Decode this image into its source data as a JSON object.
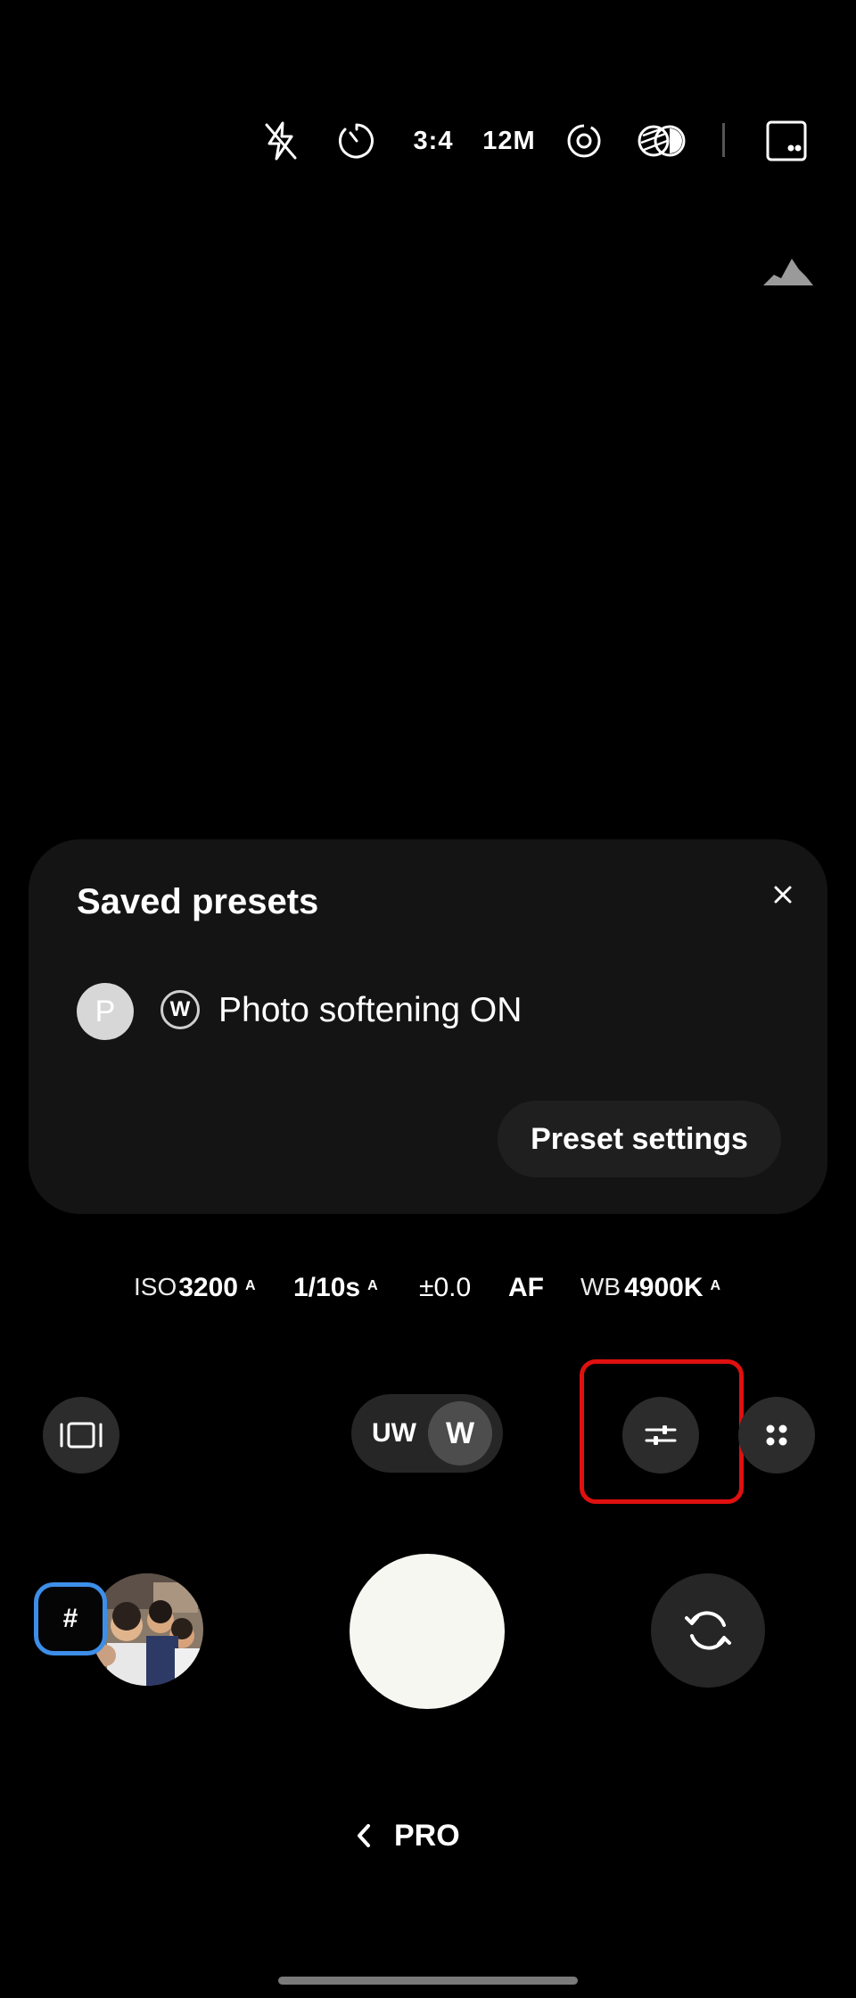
{
  "top_bar": {
    "flash_icon": "flash-off-icon",
    "timer_icon": "timer-icon",
    "aspect_ratio": "3:4",
    "resolution": "12M",
    "motion_icon": "motion-photo-icon",
    "filters_icon": "filters-icon",
    "settings_icon": "settings-icon"
  },
  "histogram_icon": "histogram-icon",
  "preset_panel": {
    "title": "Saved presets",
    "close_icon": "close-icon",
    "preset": {
      "avatar_letter": "P",
      "lens_badge": "W",
      "name": "Photo softening ON"
    },
    "settings_button": "Preset settings"
  },
  "pro_settings": [
    {
      "label": "ISO",
      "value": "3200",
      "auto": "A"
    },
    {
      "label": "",
      "value": "1/10s",
      "auto": "A"
    },
    {
      "label": "",
      "value": "±0.0",
      "auto": ""
    },
    {
      "label": "",
      "value": "AF",
      "auto": ""
    },
    {
      "label": "WB",
      "value": "4900K",
      "auto": "A"
    }
  ],
  "controls": {
    "aspect_icon": "frame-icon",
    "lens_uw": "UW",
    "lens_w": "W",
    "adjust_icon": "sliders-icon",
    "more_icon": "more-grid-icon"
  },
  "bottom": {
    "tag_label": "#",
    "thumbnail": "gallery-thumbnail",
    "shutter": "shutter-button",
    "flip_icon": "switch-camera-icon"
  },
  "mode": {
    "chevron_icon": "chevron-left-icon",
    "label": "PRO"
  },
  "colors": {
    "background": "#000000",
    "panel": "#141414",
    "highlight": "#e01010",
    "tag_border": "#3d8ee8",
    "shutter": "#f7f7f2"
  }
}
